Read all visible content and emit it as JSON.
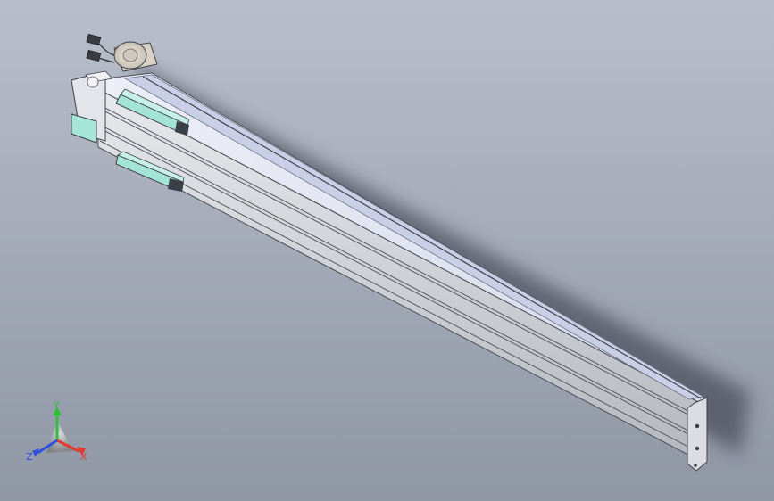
{
  "viewport": {
    "background_top": "#b6bcc8",
    "background_bottom": "#8e95a3",
    "model": {
      "body_color": "#cdd1d6",
      "cover_color": "#dfe3f0",
      "slider_color": "#9ee0d4",
      "motor_color": "#e6e0d6"
    }
  },
  "triad": {
    "x_label": "X",
    "y_label": "Y",
    "z_label": "Z",
    "x_color": "#e23a2c",
    "y_color": "#2fbf3a",
    "z_color": "#2f4fe0"
  }
}
